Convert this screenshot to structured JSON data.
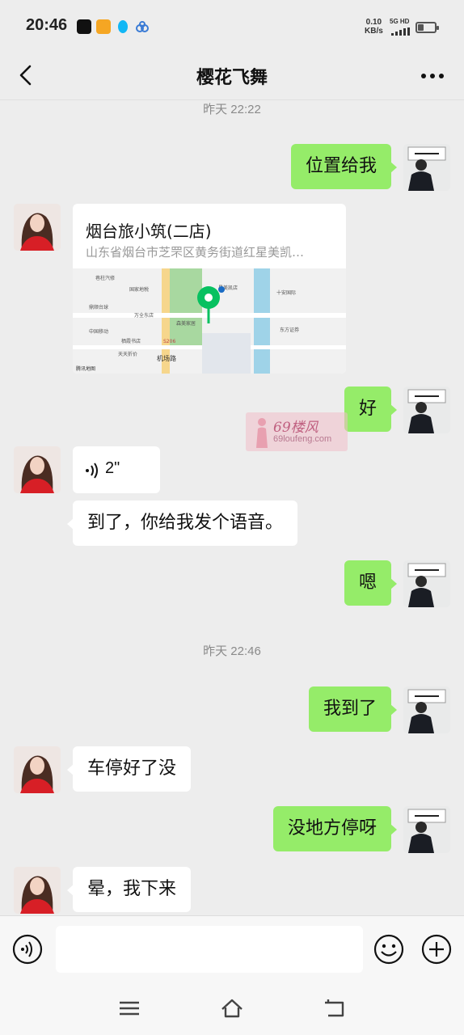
{
  "status_bar": {
    "time": "20:46",
    "speed_value": "0.10",
    "speed_unit": "KB/s",
    "network": "5G HD",
    "battery_level": 0.35,
    "notification_icons": [
      "tiktok-icon",
      "video-app-icon",
      "qq-icon",
      "cloud-app-icon"
    ]
  },
  "header": {
    "title": "樱花飞舞",
    "back_icon": "chevron-left-icon",
    "more_icon": "more-dots-icon"
  },
  "messages": {
    "ts1": "昨天 22:22",
    "m1": "位置给我",
    "location": {
      "name": "烟台旅小筑(二店)",
      "address": "山东省烟台市芝罘区黄务街道红星美凯…",
      "map_labels": {
        "l1": "巷柱汽修",
        "l2": "国家地税",
        "l3": "鼎顺台球",
        "l4": "万全东店",
        "l5": "中国移动",
        "l6": "栖霞书店",
        "l7": "天天折价",
        "l8": "机场路",
        "l9": "十安国际",
        "l10": "东方证券",
        "l11": "腾讯地图",
        "l12": "星美凯店",
        "l13": "森美家居",
        "l14": "S206"
      }
    },
    "m2": "好",
    "voice_duration": "2\"",
    "m3": "到了，你给我发个语音。",
    "m4": "嗯",
    "ts2": "昨天 22:46",
    "m5": "我到了",
    "m6": "车停好了没",
    "m7": "没地方停呀",
    "m8": "晕，我下来"
  },
  "watermark": {
    "text": "69楼风",
    "url": "69loufeng.com"
  },
  "input_bar": {
    "placeholder": "",
    "voice_icon": "voice-input-icon",
    "emoji_icon": "emoji-icon",
    "plus_icon": "plus-icon"
  },
  "colors": {
    "my_bubble": "#95ec69",
    "her_bubble": "#ffffff",
    "background": "#ededed",
    "map_pin": "#07c160"
  }
}
